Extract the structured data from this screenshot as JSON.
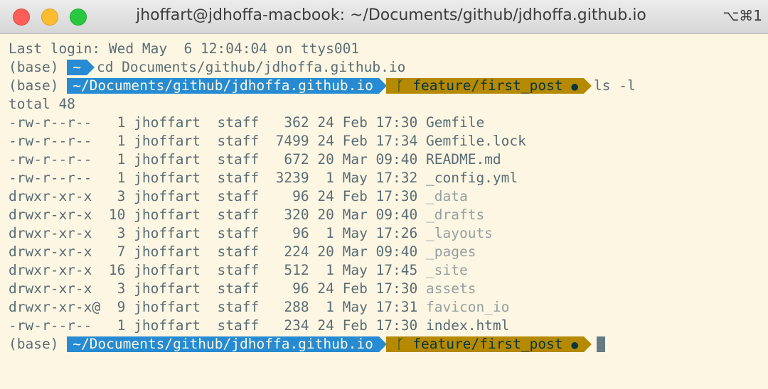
{
  "window": {
    "title": "jhoffart@jdhoffa-macbook: ~/Documents/github/jdhoffa.github.io",
    "shortcut": "⌥⌘1"
  },
  "terminal": {
    "last_login": "Last login: Wed May  6 12:04:04 on ttys001",
    "prompt_env": "(base)",
    "prompt1_dir": "~",
    "prompt1_cmd": "cd Documents/github/jdhoffa.github.io",
    "prompt2_dir": "~/Documents/github/jdhoffa.github.io",
    "branch_icon": "ᚴ",
    "branch": "feature/first_post",
    "branch_status": "●",
    "prompt2_cmd": "ls -l",
    "total": "total 48",
    "listing": [
      {
        "meta": "-rw-r--r--   1 jhoffart  staff   362 24 Feb 17:30 ",
        "name": "Gemfile",
        "type": "file"
      },
      {
        "meta": "-rw-r--r--   1 jhoffart  staff  7499 24 Feb 17:34 ",
        "name": "Gemfile.lock",
        "type": "file"
      },
      {
        "meta": "-rw-r--r--   1 jhoffart  staff   672 20 Mar 09:40 ",
        "name": "README.md",
        "type": "file"
      },
      {
        "meta": "-rw-r--r--   1 jhoffart  staff  3239  1 May 17:32 ",
        "name": "_config.yml",
        "type": "file"
      },
      {
        "meta": "drwxr-xr-x   3 jhoffart  staff    96 24 Feb 17:30 ",
        "name": "_data",
        "type": "dir"
      },
      {
        "meta": "drwxr-xr-x  10 jhoffart  staff   320 20 Mar 09:40 ",
        "name": "_drafts",
        "type": "dir"
      },
      {
        "meta": "drwxr-xr-x   3 jhoffart  staff    96  1 May 17:26 ",
        "name": "_layouts",
        "type": "dir"
      },
      {
        "meta": "drwxr-xr-x   7 jhoffart  staff   224 20 Mar 09:40 ",
        "name": "_pages",
        "type": "dir"
      },
      {
        "meta": "drwxr-xr-x  16 jhoffart  staff   512  1 May 17:45 ",
        "name": "_site",
        "type": "dir"
      },
      {
        "meta": "drwxr-xr-x   3 jhoffart  staff    96 24 Feb 17:30 ",
        "name": "assets",
        "type": "dir"
      },
      {
        "meta": "drwxr-xr-x@  9 jhoffart  staff   288  1 May 17:31 ",
        "name": "favicon_io",
        "type": "dir"
      },
      {
        "meta": "-rw-r--r--   1 jhoffart  staff   234 24 Feb 17:30 ",
        "name": "index.html",
        "type": "file"
      }
    ]
  },
  "colors": {
    "background": "#fdf6e3",
    "prompt_dir": "#268bd2",
    "prompt_branch": "#b58900",
    "text": "#586e75",
    "directory": "#93a1a1"
  }
}
